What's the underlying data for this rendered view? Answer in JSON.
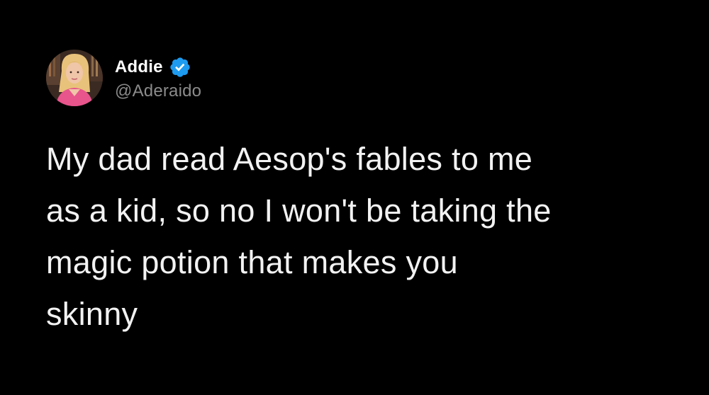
{
  "tweet": {
    "author": {
      "display_name": "Addie",
      "handle": "@Aderaido",
      "verified": true,
      "avatar_icon": "profile-photo-avatar"
    },
    "text": "My dad read Aesop's fables to me\nas a kid, so no I won't be taking the\nmagic potion that makes you\nskinny"
  },
  "colors": {
    "background": "#000000",
    "text": "#f2f2f2",
    "handle": "#8b8b8b",
    "verified_badge": "#1d9bf0"
  }
}
